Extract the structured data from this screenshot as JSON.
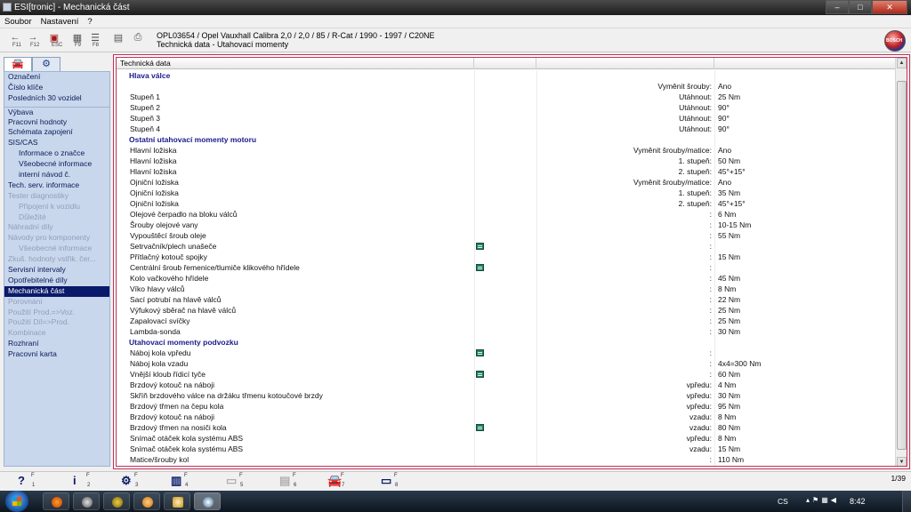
{
  "window": {
    "title": "ESI[tronic] - Mechanická část",
    "min": "–",
    "max": "□",
    "close": "✕"
  },
  "menu": [
    "Soubor",
    "Nastavení",
    "?"
  ],
  "toolbar": {
    "f11": "F11",
    "f12": "F12",
    "esc": "ESC",
    "f9": "F9",
    "f8": "F8",
    "vehicle_line1": "OPL03654 / Opel Vauxhall Calibra  2,0  / 2,0 / 85 / R-Cat / 1990 - 1997 / C20NE",
    "vehicle_line2": "Technická data - Utahovací momenty",
    "logo": "BOSCH"
  },
  "sidebar": {
    "items": [
      {
        "label": "Označení",
        "state": "normal"
      },
      {
        "label": "Číslo klíče",
        "state": "normal"
      },
      {
        "label": "Posledních 30 vozidel",
        "state": "normal"
      },
      {
        "label": "Výbava",
        "state": "normal",
        "gap": true
      },
      {
        "label": "Pracovní hodnoty",
        "state": "normal"
      },
      {
        "label": "Schémata zapojení",
        "state": "normal"
      },
      {
        "label": "SIS/CAS",
        "state": "normal"
      },
      {
        "label": "Informace o značce",
        "state": "normal",
        "sub": true
      },
      {
        "label": "Všeobecné informace",
        "state": "normal",
        "sub": true
      },
      {
        "label": "interní návod č.",
        "state": "normal",
        "sub": true
      },
      {
        "label": "Tech. serv. informace",
        "state": "normal"
      },
      {
        "label": "Tester diagnostiky",
        "state": "disabled"
      },
      {
        "label": "Připojení k vozidlu",
        "state": "disabled",
        "sub": true
      },
      {
        "label": "Důležité",
        "state": "disabled",
        "sub": true
      },
      {
        "label": "Náhradní díly",
        "state": "disabled"
      },
      {
        "label": "Návody pro komponenty",
        "state": "disabled"
      },
      {
        "label": "Všeobecné informace",
        "state": "disabled",
        "sub": true
      },
      {
        "label": "Zkuš. hodnoty vstřik. čer...",
        "state": "disabled"
      },
      {
        "label": "Servisní intervaly",
        "state": "normal"
      },
      {
        "label": "Opotřebitelné díly",
        "state": "normal"
      },
      {
        "label": "Mechanická část",
        "state": "active"
      },
      {
        "label": "Porovnání",
        "state": "disabled"
      },
      {
        "label": "Použití Prod.=>Voz.",
        "state": "disabled"
      },
      {
        "label": "Použití Díl=>Prod.",
        "state": "disabled"
      },
      {
        "label": "Kombinace",
        "state": "disabled"
      },
      {
        "label": "Rozhraní",
        "state": "normal"
      },
      {
        "label": "Pracovní karta",
        "state": "normal"
      }
    ]
  },
  "table": {
    "header": "Technická data",
    "rows": [
      {
        "type": "section",
        "c1": "Hlava válce"
      },
      {
        "c1": "",
        "c3": "Vyměnit šrouby:",
        "c4": "Ano"
      },
      {
        "c1": "Stupeň 1",
        "c3": "Utáhnout:",
        "c4": "25 Nm"
      },
      {
        "c1": "Stupeň 2",
        "c3": "Utáhnout:",
        "c4": "90°"
      },
      {
        "c1": "Stupeň 3",
        "c3": "Utáhnout:",
        "c4": "90°"
      },
      {
        "c1": "Stupeň 4",
        "c3": "Utáhnout:",
        "c4": "90°"
      },
      {
        "type": "section",
        "c1": "Ostatní utahovací momenty motoru"
      },
      {
        "c1": "Hlavní ložiska",
        "c3": "Vyměnit šrouby/matice:",
        "c4": "Ano"
      },
      {
        "c1": "Hlavní ložiska",
        "c3": "1. stupeň:",
        "c4": "50 Nm"
      },
      {
        "c1": "Hlavní ložiska",
        "c3": "2. stupeň:",
        "c4": "45°+15°"
      },
      {
        "c1": "Ojniční ložiska",
        "c3": "Vyměnit šrouby/matice:",
        "c4": "Ano"
      },
      {
        "c1": "Ojniční ložiska",
        "c3": "1. stupeň:",
        "c4": "35 Nm"
      },
      {
        "c1": "Ojniční ložiska",
        "c3": "2. stupeň:",
        "c4": "45°+15°"
      },
      {
        "c1": "Olejové čerpadlo na bloku válců",
        "c3": ":",
        "c4": "6 Nm"
      },
      {
        "c1": "Šrouby olejové vany",
        "c3": ":",
        "c4": "10-15 Nm"
      },
      {
        "c1": "Vypouštěcí šroub oleje",
        "c3": ":",
        "c4": "55 Nm"
      },
      {
        "c1": "Setrvačník/plech unašeče",
        "icon": true,
        "c3": ":",
        "c4": ""
      },
      {
        "c1": "Přítlačný kotouč spojky",
        "c3": ":",
        "c4": "15 Nm"
      },
      {
        "c1": "Centrální šroub řemenice/tlumiče klikového hřídele",
        "icon": true,
        "c3": ":",
        "c4": ""
      },
      {
        "c1": "Kolo vačkového hřídele",
        "c3": ":",
        "c4": "45 Nm"
      },
      {
        "c1": "Víko hlavy válců",
        "c3": ":",
        "c4": "8 Nm"
      },
      {
        "c1": "Sací potrubí na hlavě válců",
        "c3": ":",
        "c4": "22 Nm"
      },
      {
        "c1": "Výfukový sběrač na hlavě válců",
        "c3": ":",
        "c4": "25 Nm"
      },
      {
        "c1": "Zapalovací svíčky",
        "c3": ":",
        "c4": "25 Nm"
      },
      {
        "c1": "Lambda-sonda",
        "c3": ":",
        "c4": "30 Nm"
      },
      {
        "type": "section",
        "c1": "Utahovací momenty podvozku"
      },
      {
        "c1": "Náboj kola vpředu",
        "icon": true,
        "c3": ":",
        "c4": ""
      },
      {
        "c1": "Náboj kola vzadu",
        "c3": ":",
        "c4": "4x4=300 Nm"
      },
      {
        "c1": "Vnější kloub řídicí tyče",
        "icon": true,
        "c3": ":",
        "c4": "60 Nm"
      },
      {
        "c1": "Brzdový kotouč na náboji",
        "c3": "vpředu:",
        "c4": "4 Nm"
      },
      {
        "c1": "Skříň brzdového válce na držáku třmenu kotoučové brzdy",
        "c3": "vpředu:",
        "c4": "30 Nm"
      },
      {
        "c1": "Brzdový třmen na čepu kola",
        "c3": "vpředu:",
        "c4": "95 Nm"
      },
      {
        "c1": "Brzdový kotouč na náboji",
        "c3": "vzadu:",
        "c4": "8 Nm"
      },
      {
        "c1": "Brzdový třmen na nosiči kola",
        "icon": true,
        "c3": "vzadu:",
        "c4": "80 Nm"
      },
      {
        "c1": "Snímač otáček kola systému ABS",
        "c3": "vpředu:",
        "c4": "8 Nm"
      },
      {
        "c1": "Snímač otáček kola systému ABS",
        "c3": "vzadu:",
        "c4": "15 Nm"
      },
      {
        "c1": "Matice/šrouby kol",
        "c3": ":",
        "c4": "110 Nm"
      }
    ]
  },
  "bottom": {
    "keys": [
      "1",
      "2",
      "3",
      "4",
      "5",
      "6",
      "7",
      "8"
    ],
    "page": "1/39"
  },
  "taskbar": {
    "lang": "CS",
    "time": "8:42"
  }
}
